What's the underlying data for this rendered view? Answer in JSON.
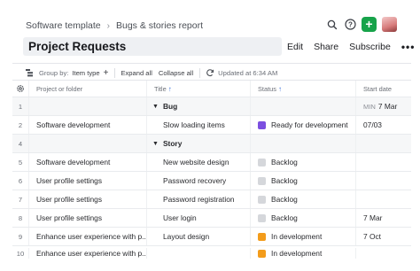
{
  "breadcrumb": {
    "items": [
      "Software template",
      "Bugs & stories report"
    ]
  },
  "page": {
    "title": "Project Requests"
  },
  "actions": {
    "edit": "Edit",
    "share": "Share",
    "subscribe": "Subscribe",
    "more": "•••"
  },
  "toolbar": {
    "group_by_label": "Group by:",
    "group_by_value": "Item type",
    "expand_all": "Expand all",
    "collapse_all": "Collapse all",
    "updated": "Updated at 6:34 AM"
  },
  "columns": {
    "project": "Project or folder",
    "title": "Title",
    "status": "Status",
    "start": "Start date"
  },
  "groups": {
    "bug": "Bug",
    "story": "Story"
  },
  "rows": [
    {
      "num": "1",
      "project": "",
      "title": "",
      "status": "",
      "start": "7 Mar",
      "start_prefix": "MIN"
    },
    {
      "num": "2",
      "project": "Software development",
      "title": "Slow loading items",
      "status": "Ready for development",
      "start": "07/03"
    },
    {
      "num": "4",
      "project": "",
      "title": "",
      "status": "",
      "start": ""
    },
    {
      "num": "5",
      "project": "Software development",
      "title": "New website design",
      "status": "Backlog",
      "start": ""
    },
    {
      "num": "6",
      "project": "User profile settings",
      "title": "Password recovery",
      "status": "Backlog",
      "start": ""
    },
    {
      "num": "7",
      "project": "User profile settings",
      "title": "Password registration",
      "status": "Backlog",
      "start": ""
    },
    {
      "num": "8",
      "project": "User profile settings",
      "title": "User login",
      "status": "Backlog",
      "start": "7 Mar"
    },
    {
      "num": "9",
      "project": "Enhance user experience with p...",
      "title": "Layout design",
      "status": "In development",
      "start": "7 Oct"
    },
    {
      "num": "10",
      "project": "Enhance user experience with p...",
      "title": "",
      "status": "In development",
      "start": ""
    }
  ],
  "status_colors": {
    "ready": "#7b4fe0",
    "backlog": "#d5d7db",
    "in_development": "#f39c1b"
  },
  "icons": [
    "search-icon",
    "help-icon",
    "plus-icon",
    "avatar",
    "group-by-icon",
    "refresh-icon",
    "settings-icon"
  ]
}
